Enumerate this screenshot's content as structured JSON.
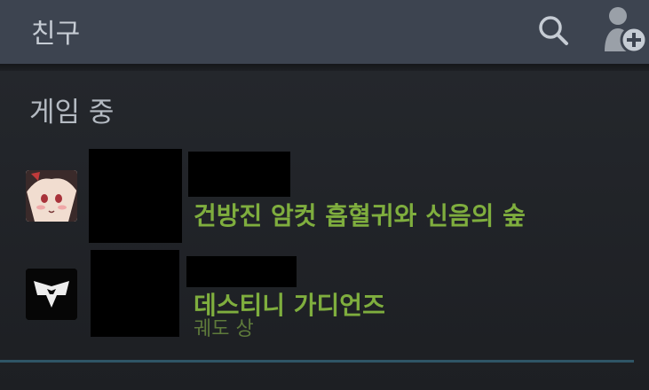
{
  "header": {
    "title": "친구",
    "search_icon": "search-icon",
    "add_friend_icon": "add-friend-icon"
  },
  "section": {
    "title": "게임 중"
  },
  "friends": [
    {
      "game": "건방진 암컷 흡혈귀와 신음의 숲",
      "subtitle": "",
      "icon": "anime-girl-game-icon"
    },
    {
      "game": "데스티니 가디언즈",
      "subtitle": "궤도 상",
      "icon": "destiny-logo-icon"
    }
  ],
  "colors": {
    "header_bg": "#3d4450",
    "body_bg": "#1e2024",
    "ingame_green": "#7fae3e",
    "divider": "#2f5566"
  }
}
